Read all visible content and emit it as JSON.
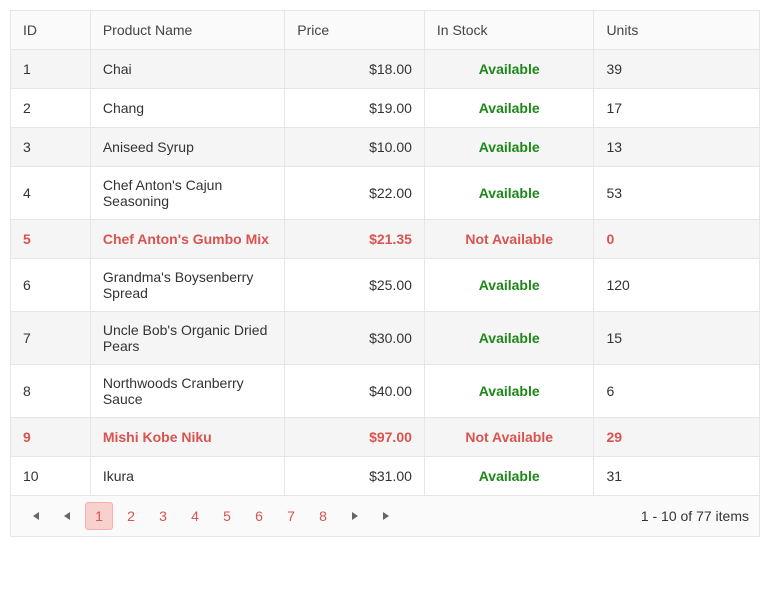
{
  "columns": {
    "id": "ID",
    "name": "Product Name",
    "price": "Price",
    "stock": "In Stock",
    "units": "Units"
  },
  "stock_labels": {
    "available": "Available",
    "not_available": "Not Available"
  },
  "rows": [
    {
      "id": "1",
      "name": "Chai",
      "price": "$18.00",
      "available": true,
      "units": "39",
      "discontinued": false
    },
    {
      "id": "2",
      "name": "Chang",
      "price": "$19.00",
      "available": true,
      "units": "17",
      "discontinued": false
    },
    {
      "id": "3",
      "name": "Aniseed Syrup",
      "price": "$10.00",
      "available": true,
      "units": "13",
      "discontinued": false
    },
    {
      "id": "4",
      "name": "Chef Anton's Cajun Seasoning",
      "price": "$22.00",
      "available": true,
      "units": "53",
      "discontinued": false
    },
    {
      "id": "5",
      "name": "Chef Anton's Gumbo Mix",
      "price": "$21.35",
      "available": false,
      "units": "0",
      "discontinued": true
    },
    {
      "id": "6",
      "name": "Grandma's Boysenberry Spread",
      "price": "$25.00",
      "available": true,
      "units": "120",
      "discontinued": false
    },
    {
      "id": "7",
      "name": "Uncle Bob's Organic Dried Pears",
      "price": "$30.00",
      "available": true,
      "units": "15",
      "discontinued": false
    },
    {
      "id": "8",
      "name": "Northwoods Cranberry Sauce",
      "price": "$40.00",
      "available": true,
      "units": "6",
      "discontinued": false
    },
    {
      "id": "9",
      "name": "Mishi Kobe Niku",
      "price": "$97.00",
      "available": false,
      "units": "29",
      "discontinued": true
    },
    {
      "id": "10",
      "name": "Ikura",
      "price": "$31.00",
      "available": true,
      "units": "31",
      "discontinued": false
    }
  ],
  "pager": {
    "pages": [
      "1",
      "2",
      "3",
      "4",
      "5",
      "6",
      "7",
      "8"
    ],
    "current": "1",
    "info": "1 - 10 of 77 items"
  }
}
